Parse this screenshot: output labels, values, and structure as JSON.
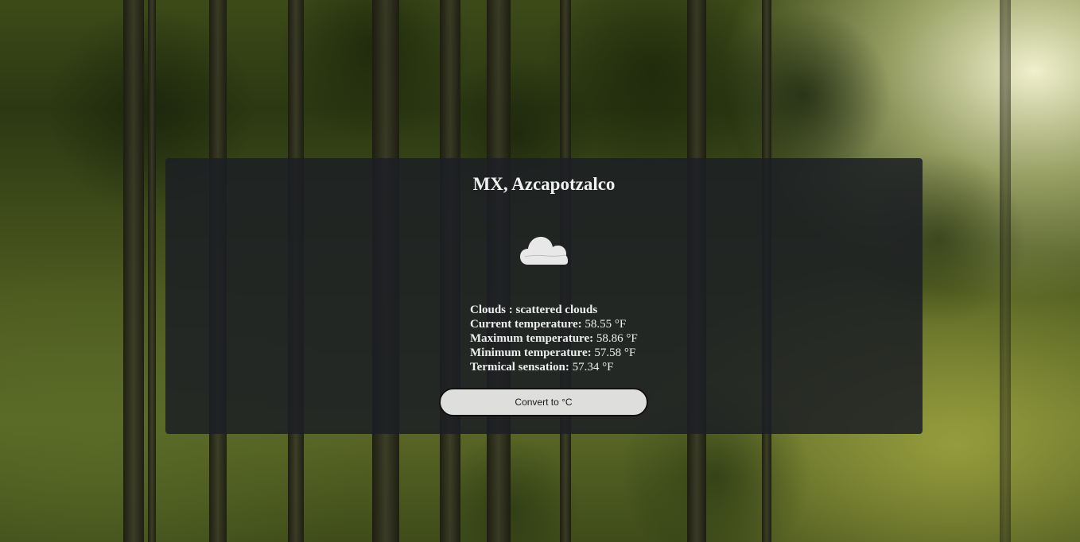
{
  "location": {
    "title": "MX, Azcapotzalco"
  },
  "weather": {
    "icon": "cloud-icon",
    "icon_color": "#e8e8e8",
    "condition_label": "Clouds",
    "condition_separator": " : ",
    "condition_value": "scattered clouds",
    "rows": [
      {
        "label": "Current temperature:",
        "value": "58.55 °F"
      },
      {
        "label": "Maximum temperature:",
        "value": "58.86 °F"
      },
      {
        "label": "Minimum temperature:",
        "value": "57.58 °F"
      },
      {
        "label": "Termical sensation:",
        "value": "57.34 °F"
      }
    ]
  },
  "actions": {
    "convert_label": "Convert to °C"
  },
  "colors": {
    "card_background": "#1c1e24",
    "button_background": "#dededc",
    "text": "#eeeeee"
  }
}
